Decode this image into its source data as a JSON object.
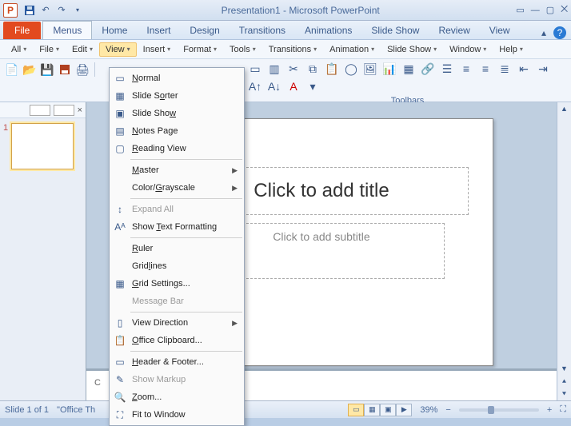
{
  "title": "Presentation1  -  Microsoft PowerPoint",
  "app_glyph": "P",
  "tabs": {
    "file": "File",
    "list": [
      "Menus",
      "Home",
      "Insert",
      "Design",
      "Transitions",
      "Animations",
      "Slide Show",
      "Review",
      "View"
    ],
    "active": "Menus"
  },
  "menubar": [
    "All",
    "File",
    "Edit",
    "View",
    "Insert",
    "Format",
    "Tools",
    "Transitions",
    "Animation",
    "Slide Show",
    "Window",
    "Help"
  ],
  "menubar_active": "View",
  "toolbars_label": "Toolbars",
  "view_menu": {
    "groups": [
      [
        {
          "id": "normal",
          "label": "Normal",
          "icon": "▭",
          "mn": "N"
        },
        {
          "id": "slide-sorter",
          "label": "Slide Sorter",
          "icon": "▦",
          "mn": "o"
        },
        {
          "id": "slide-show",
          "label": "Slide Show",
          "icon": "▣",
          "mn": "w"
        },
        {
          "id": "notes-page",
          "label": "Notes Page",
          "icon": "▤",
          "mn": "N"
        },
        {
          "id": "reading-view",
          "label": "Reading View",
          "icon": "▢",
          "mn": "R"
        }
      ],
      [
        {
          "id": "master",
          "label": "Master",
          "icon": "",
          "sub": true,
          "mn": "M"
        },
        {
          "id": "color-grayscale",
          "label": "Color/Grayscale",
          "icon": "",
          "sub": true,
          "mn": "G"
        }
      ],
      [
        {
          "id": "expand-all",
          "label": "Expand All",
          "icon": "↕",
          "disabled": true
        },
        {
          "id": "show-text-formatting",
          "label": "Show Text Formatting",
          "icon": "Aᴬ",
          "mn": "T"
        }
      ],
      [
        {
          "id": "ruler",
          "label": "Ruler",
          "icon": "",
          "mn": "R"
        },
        {
          "id": "gridlines",
          "label": "Gridlines",
          "icon": "",
          "mn": "l"
        },
        {
          "id": "grid-settings",
          "label": "Grid Settings...",
          "icon": "▦",
          "mn": "G"
        },
        {
          "id": "message-bar",
          "label": "Message Bar",
          "icon": "",
          "disabled": true
        }
      ],
      [
        {
          "id": "view-direction",
          "label": "View Direction",
          "icon": "▯",
          "sub": true
        },
        {
          "id": "office-clipboard",
          "label": "Office Clipboard...",
          "icon": "📋",
          "mn": "O"
        }
      ],
      [
        {
          "id": "header-footer",
          "label": "Header & Footer...",
          "icon": "▭",
          "mn": "H"
        },
        {
          "id": "show-markup",
          "label": "Show Markup",
          "icon": "✎",
          "disabled": true
        },
        {
          "id": "zoom",
          "label": "Zoom...",
          "icon": "🔍",
          "mn": "Z"
        },
        {
          "id": "fit-to-window",
          "label": "Fit to Window",
          "icon": "⛶"
        }
      ]
    ]
  },
  "slide": {
    "number": "1",
    "title_ph": "Click to add title",
    "subtitle_ph": "Click to add subtitle"
  },
  "notes_prefix": "C",
  "status": {
    "slide_of": "Slide 1 of 1",
    "theme": "\"Office Th",
    "zoom": "39%"
  }
}
